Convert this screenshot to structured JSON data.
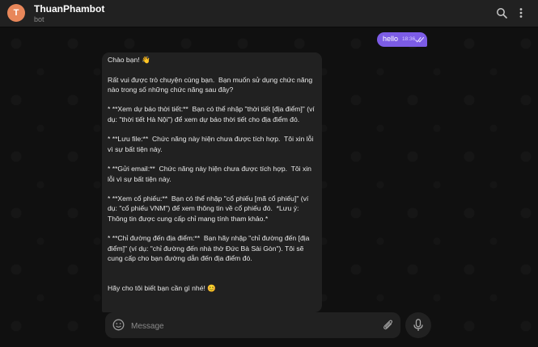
{
  "header": {
    "avatar_letter": "T",
    "title": "ThuanPhambot",
    "subtitle": "bot",
    "search_icon": "search-icon",
    "menu_icon": "more-vertical-icon"
  },
  "messages": {
    "outgoing": {
      "text": "hello",
      "time": "18:36",
      "status_icon": "double-check-icon"
    },
    "incoming": {
      "text": "Chào bạn! 👋\n\nRất vui được trò chuyện cùng bạn.  Bạn muốn sử dụng chức năng nào trong số những chức năng sau đây?\n\n* **Xem dự báo thời tiết:**  Bạn có thể nhập \"thời tiết [địa điểm]\" (ví dụ: \"thời tiết Hà Nội\") để xem dự báo thời tiết cho địa điểm đó.\n\n* **Lưu file:**  Chức năng này hiện chưa được tích hợp.  Tôi xin lỗi vì sự bất tiện này.\n\n* **Gửi email:**  Chức năng này hiện chưa được tích hợp.  Tôi xin lỗi vì sự bất tiện này.\n\n* **Xem cổ phiếu:**  Bạn có thể nhập \"cổ phiếu [mã cổ phiếu]\" (ví dụ: \"cổ phiếu VNM\") để xem thông tin về cổ phiếu đó.  *Lưu ý: Thông tin được cung cấp chỉ mang tính tham khảo.*\n\n* **Chỉ đường đến địa điểm:**  Bạn hãy nhập \"chỉ đường đến [địa điểm]\" (ví dụ: \"chỉ đường đến nhà thờ Đức Bà Sài Gòn\"). Tôi sẽ cung cấp cho bạn đường dẫn đến địa điểm đó.\n\n\nHãy cho tôi biết bạn cần gì nhé! 😊"
    }
  },
  "composer": {
    "placeholder": "Message",
    "emoji_icon": "emoji-icon",
    "attach_icon": "paperclip-icon",
    "mic_icon": "microphone-icon"
  },
  "colors": {
    "accent": "#7c5ce6",
    "background": "#101010",
    "panel": "#212121"
  }
}
